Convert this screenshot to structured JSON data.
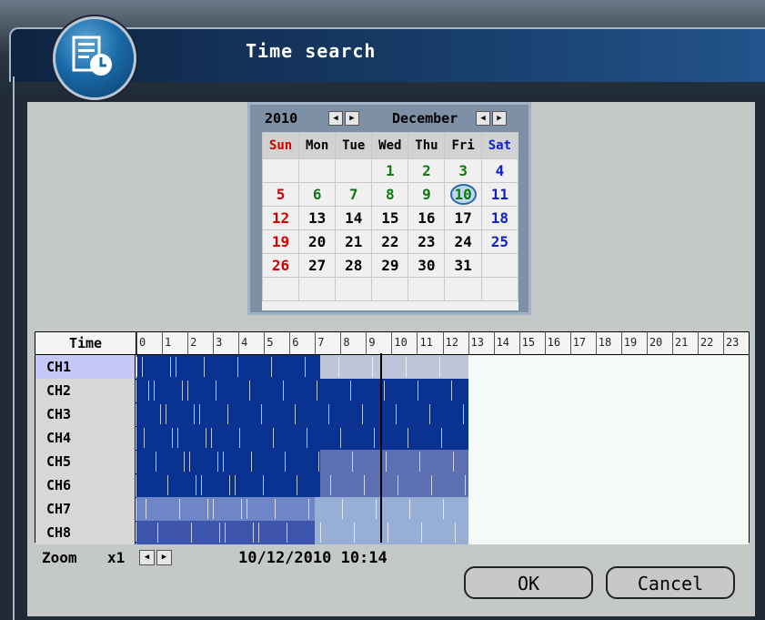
{
  "window": {
    "title": "Time search"
  },
  "calendar": {
    "year": "2010",
    "month": "December",
    "weekdays": [
      "Sun",
      "Mon",
      "Tue",
      "Wed",
      "Thu",
      "Fri",
      "Sat"
    ],
    "weeks": [
      [
        "",
        "",
        "",
        "1",
        "2",
        "3",
        "4"
      ],
      [
        "5",
        "6",
        "7",
        "8",
        "9",
        "10",
        "11"
      ],
      [
        "12",
        "13",
        "14",
        "15",
        "16",
        "17",
        "18"
      ],
      [
        "19",
        "20",
        "21",
        "22",
        "23",
        "24",
        "25"
      ],
      [
        "26",
        "27",
        "28",
        "29",
        "30",
        "31",
        ""
      ],
      [
        "",
        "",
        "",
        "",
        "",
        "",
        ""
      ]
    ],
    "recorded_days": [
      "1",
      "2",
      "3",
      "4",
      "5",
      "6",
      "7",
      "8",
      "9",
      "10"
    ],
    "selected_day": "10",
    "colors": {
      "sunday": "#d40000",
      "saturday": "#1020d0",
      "recorded": "#107a10",
      "normal": "#000000"
    }
  },
  "timeline": {
    "header_label": "Time",
    "hours": [
      "0",
      "1",
      "2",
      "3",
      "4",
      "5",
      "6",
      "7",
      "8",
      "9",
      "10",
      "11",
      "12",
      "13",
      "14",
      "15",
      "16",
      "17",
      "18",
      "19",
      "20",
      "21",
      "22",
      "23"
    ],
    "channels": [
      {
        "label": "CH1",
        "active": true,
        "segments": [
          [
            0,
            7.2,
            "#0a3391"
          ],
          [
            7.2,
            13,
            "#bcc6d8"
          ]
        ]
      },
      {
        "label": "CH2",
        "active": false,
        "segments": [
          [
            0,
            13,
            "#0a3391"
          ]
        ]
      },
      {
        "label": "CH3",
        "active": false,
        "segments": [
          [
            0,
            13,
            "#0a3391"
          ]
        ]
      },
      {
        "label": "CH4",
        "active": false,
        "segments": [
          [
            0,
            13,
            "#0a3391"
          ]
        ]
      },
      {
        "label": "CH5",
        "active": false,
        "segments": [
          [
            0,
            7.2,
            "#0a3391"
          ],
          [
            7.2,
            13,
            "#5c6fb0"
          ]
        ]
      },
      {
        "label": "CH6",
        "active": false,
        "segments": [
          [
            0,
            7.2,
            "#0a3391"
          ],
          [
            7.2,
            13,
            "#5c6fb0"
          ]
        ]
      },
      {
        "label": "CH7",
        "active": false,
        "segments": [
          [
            0,
            7,
            "#6f86c6"
          ],
          [
            7,
            13,
            "#97aed6"
          ]
        ]
      },
      {
        "label": "CH8",
        "active": false,
        "segments": [
          [
            0,
            7,
            "#3c54ac"
          ],
          [
            7,
            13,
            "#97aed6"
          ]
        ]
      }
    ],
    "cursor_hour": 9.6,
    "colors": {
      "recorded_full": "#0a3391",
      "empty": "#f4faf7"
    }
  },
  "footer": {
    "zoom_label": "Zoom",
    "zoom_value": "x1",
    "datetime": "10/12/2010 10:14",
    "ok_label": "OK",
    "cancel_label": "Cancel"
  }
}
